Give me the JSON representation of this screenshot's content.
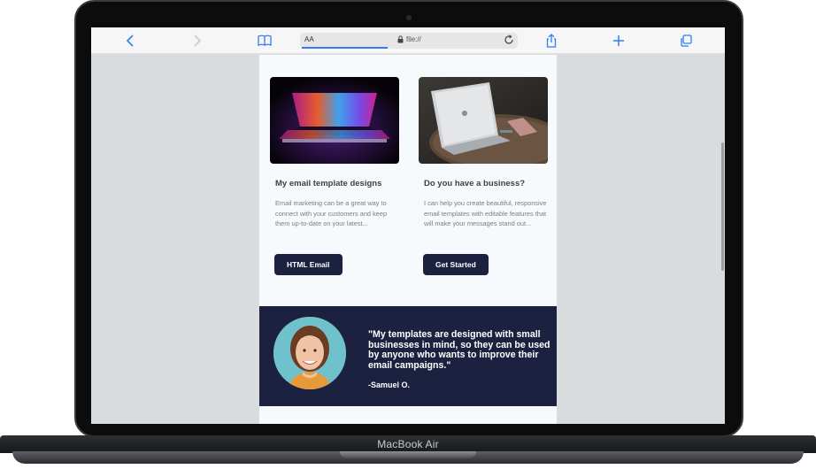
{
  "device": {
    "brand_label": "MacBook Air"
  },
  "browser": {
    "address_bar": {
      "text_size_label": "AA",
      "url": "file://"
    },
    "icons": [
      "back-icon",
      "forward-icon",
      "bookmarks-icon",
      "lock-icon",
      "reload-icon",
      "share-icon",
      "new-tab-icon",
      "tabs-icon"
    ],
    "accent_color": "#2f7cf6"
  },
  "email": {
    "cards": [
      {
        "title": "My email template designs",
        "description": "Email marketing can be a great way to connect with your customers and keep them up-to-date on your latest...",
        "button_label": "HTML Email"
      },
      {
        "title": "Do you have a business?",
        "description": "I can help you create beautiful, responsive email templates with editable features that will make your messages stand out...",
        "button_label": "Get Started"
      }
    ],
    "testimonial": {
      "quote": "\"My templates are designed with small businesses in mind, so they can be used by anyone who wants to improve their email campaigns.\"",
      "author": "-Samuel O."
    },
    "colors": {
      "navy": "#1c2140",
      "page_bg": "#f6fafc",
      "outer_bg": "#d8dcde"
    }
  }
}
